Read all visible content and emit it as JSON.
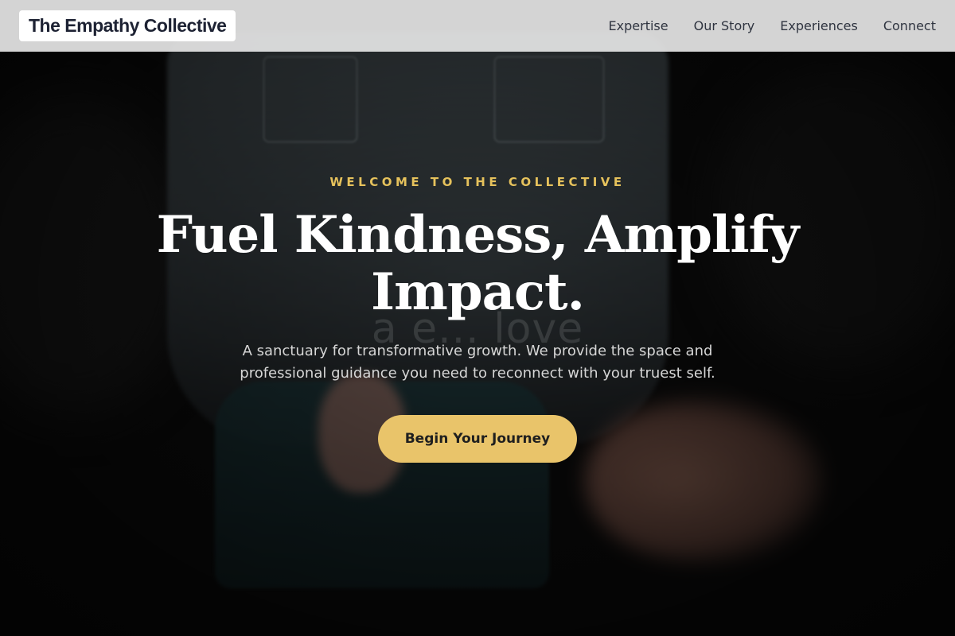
{
  "brand": {
    "name": "The Empathy Collective"
  },
  "nav": {
    "items": [
      {
        "label": "Expertise"
      },
      {
        "label": "Our Story"
      },
      {
        "label": "Experiences"
      },
      {
        "label": "Connect"
      }
    ]
  },
  "hero": {
    "eyebrow": "Welcome to the Collective",
    "headline": "Fuel Kindness, Amplify Impact.",
    "background_text": "a e... love",
    "subtitle": "A sanctuary for transformative growth. We provide the space and professional guidance you need to reconnect with your truest self.",
    "cta_label": "Begin Your Journey"
  },
  "colors": {
    "accent": "#e9c46a",
    "eyebrow": "#e6c25c",
    "header_bg": "#e6e6e6",
    "brand_text": "#1d2233"
  }
}
